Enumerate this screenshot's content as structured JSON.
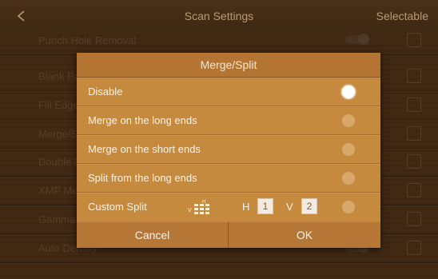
{
  "header": {
    "title": "Scan Settings",
    "right_action": "Selectable"
  },
  "background_rows": [
    {
      "label": "Punch Hole Removal",
      "toggle": true
    },
    {
      "label": "Blank Page Removal",
      "toggle": false
    },
    {
      "label": "Fill Edges",
      "toggle": false
    },
    {
      "label": "Merge/Split",
      "toggle": false
    },
    {
      "label": "Double Feed Detection",
      "toggle": false
    },
    {
      "label": "XMP Metadata",
      "toggle": false
    },
    {
      "label": "Gamma",
      "toggle": false
    },
    {
      "label": "Auto Density",
      "toggle": true
    }
  ],
  "dialog": {
    "title": "Merge/Split",
    "options": [
      {
        "label": "Disable",
        "selected": true
      },
      {
        "label": "Merge on the long ends",
        "selected": false
      },
      {
        "label": "Merge on the short ends",
        "selected": false
      },
      {
        "label": "Split from the long ends",
        "selected": false
      },
      {
        "label": "Custom Split",
        "selected": false
      }
    ],
    "custom_split": {
      "h_label": "H",
      "h_value": "1",
      "v_label": "V",
      "v_value": "2",
      "icon_h": "H",
      "icon_v": "V"
    },
    "cancel_label": "Cancel",
    "ok_label": "OK"
  },
  "colors": {
    "dialog_bg": "#c68a3e",
    "dialog_title_bg": "#b47432",
    "app_bg": "#5a3a1c"
  }
}
